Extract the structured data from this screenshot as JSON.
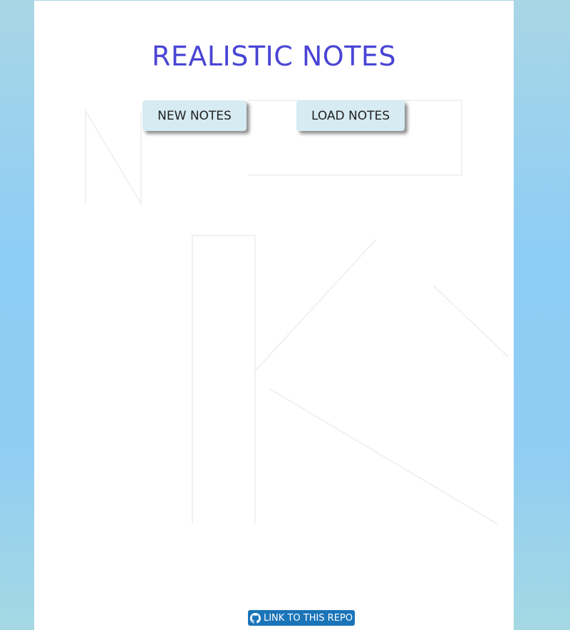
{
  "app": {
    "title": "REALISTIC NOTES"
  },
  "actions": {
    "new_label": "NEW NOTES",
    "load_label": "LOAD NOTES"
  },
  "footer": {
    "repo_link_label": "LINK TO THIS REPO",
    "repo_icon": "github-icon"
  },
  "colors": {
    "title": "#4a45d4",
    "button_bg": "#d6ebf2",
    "link_bg": "#1a74b8",
    "side_bg": "#90cdf4"
  }
}
